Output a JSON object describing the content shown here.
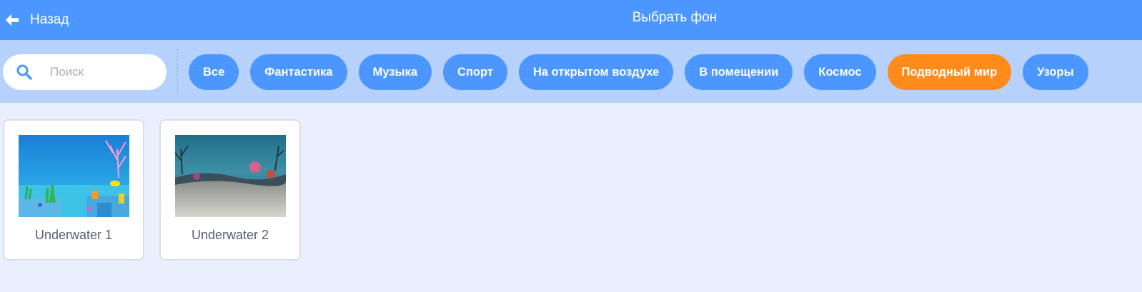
{
  "header": {
    "back_label": "Назад",
    "title": "Выбрать фон",
    "back_icon": "arrow-left-icon"
  },
  "search": {
    "placeholder": "Поиск",
    "value": "",
    "icon": "search-icon"
  },
  "tags": [
    {
      "label": "Все",
      "active": false
    },
    {
      "label": "Фантастика",
      "active": false
    },
    {
      "label": "Музыка",
      "active": false
    },
    {
      "label": "Спорт",
      "active": false
    },
    {
      "label": "На открытом воздухе",
      "active": false
    },
    {
      "label": "В помещении",
      "active": false
    },
    {
      "label": "Космос",
      "active": false
    },
    {
      "label": "Подводный мир",
      "active": true
    },
    {
      "label": "Узоры",
      "active": false
    }
  ],
  "backdrops": [
    {
      "name": "Underwater 1"
    },
    {
      "name": "Underwater 2"
    }
  ],
  "colors": {
    "header": "#4c97ff",
    "filter_bar": "#b6d1fc",
    "tag": "#4c97ff",
    "tag_active": "#ff8c1a",
    "background": "#e8f0fd"
  }
}
